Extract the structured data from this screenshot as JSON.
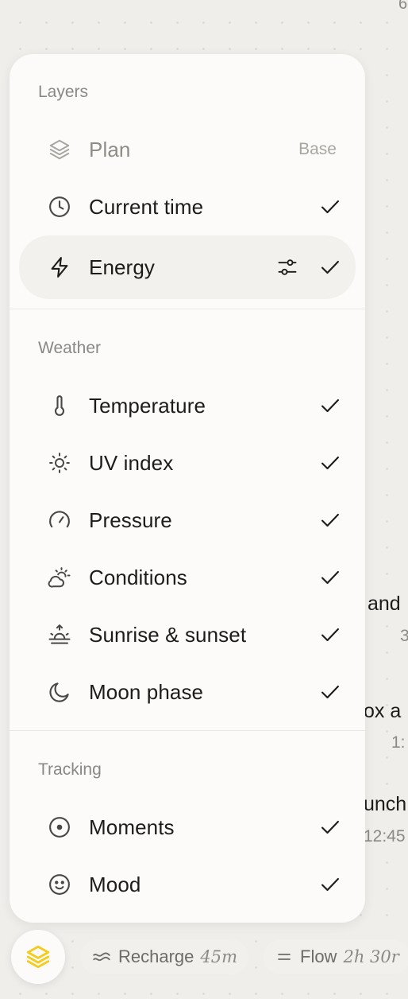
{
  "background": {
    "top_right_text": "6",
    "event1_title": "and",
    "event1_sub": "3",
    "event2_title": "ox a",
    "event2_sub": "1:",
    "event3_title": "unch",
    "event3_sub": "12:45"
  },
  "layers_section": {
    "title": "Layers",
    "items": [
      {
        "label": "Plan",
        "badge": "Base",
        "icon": "layers-icon"
      },
      {
        "label": "Current time",
        "icon": "clock-icon"
      },
      {
        "label": "Energy",
        "icon": "lightning-icon"
      }
    ]
  },
  "weather_section": {
    "title": "Weather",
    "items": [
      {
        "label": "Temperature",
        "icon": "thermometer-icon"
      },
      {
        "label": "UV index",
        "icon": "sun-icon"
      },
      {
        "label": "Pressure",
        "icon": "gauge-icon"
      },
      {
        "label": "Conditions",
        "icon": "partly-cloudy-icon"
      },
      {
        "label": "Sunrise & sunset",
        "icon": "sunrise-icon"
      },
      {
        "label": "Moon phase",
        "icon": "moon-icon"
      }
    ]
  },
  "tracking_section": {
    "title": "Tracking",
    "items": [
      {
        "label": "Moments",
        "icon": "target-icon"
      },
      {
        "label": "Mood",
        "icon": "smiley-icon"
      }
    ]
  },
  "bottom_bar": {
    "chip1_label": "Recharge",
    "chip1_duration": "45m",
    "chip2_label": "Flow",
    "chip2_duration": "2h 30r"
  },
  "colors": {
    "accent_yellow": "#f2cc1f",
    "panel_bg": "#fcfbf9",
    "page_bg": "#efeeeb"
  }
}
